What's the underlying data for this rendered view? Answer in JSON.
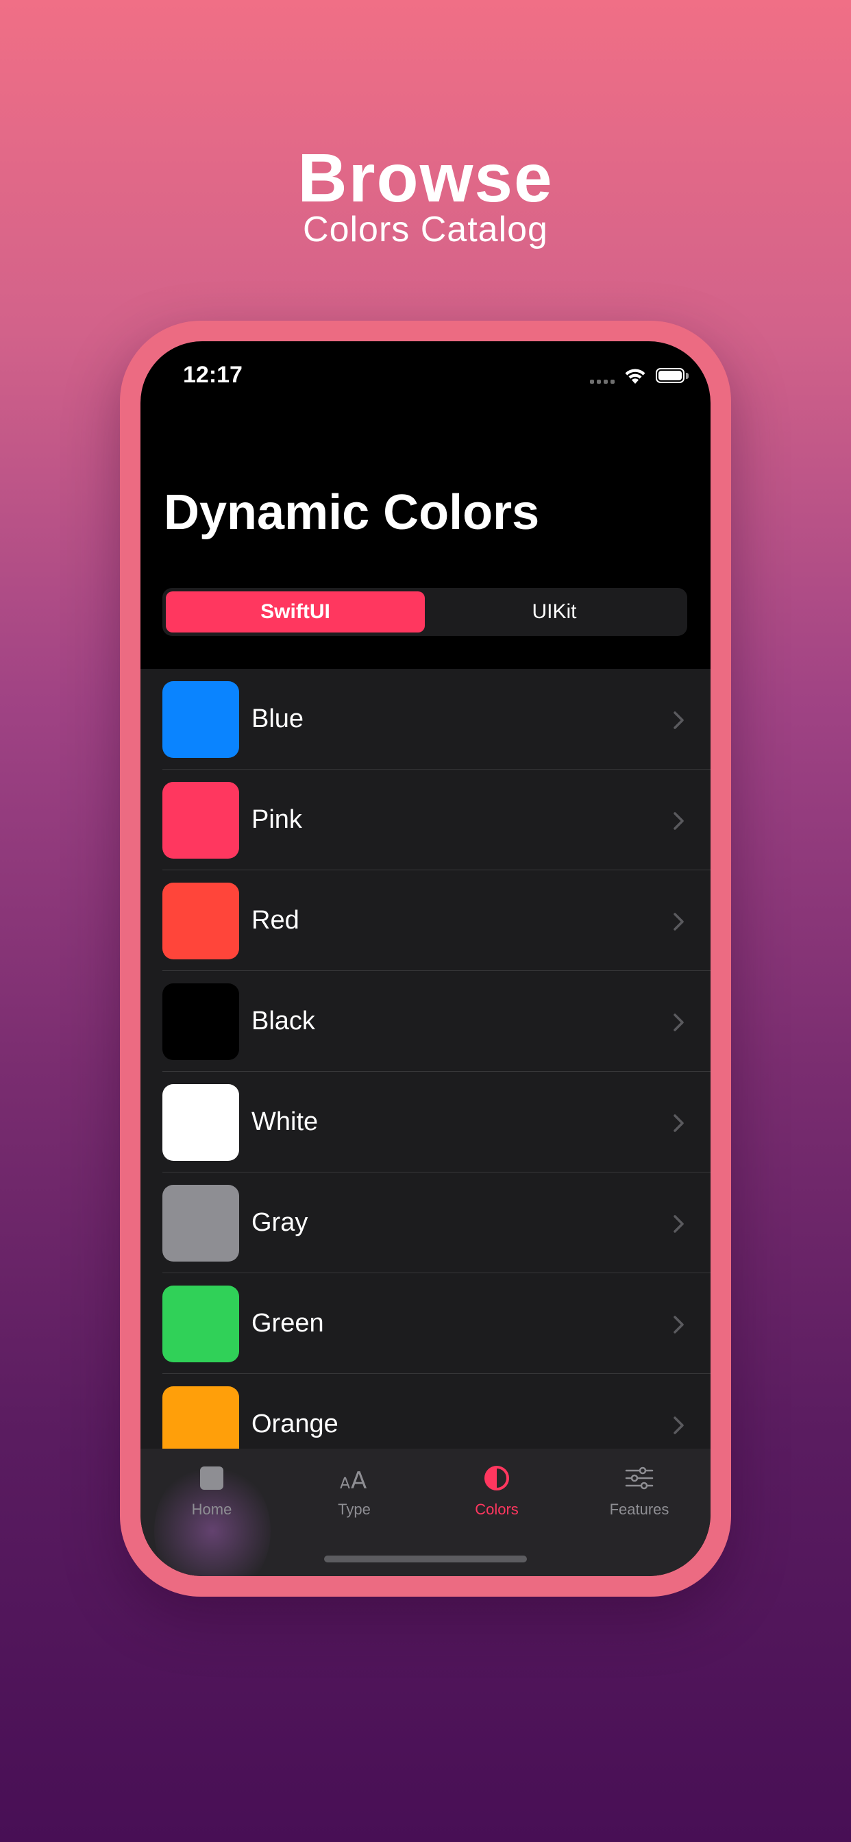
{
  "hero": {
    "title": "Browse",
    "subtitle": "Colors Catalog"
  },
  "status_bar": {
    "time": "12:17"
  },
  "page": {
    "title": "Dynamic Colors"
  },
  "segmented": {
    "options": [
      "SwiftUI",
      "UIKit"
    ],
    "selected": "SwiftUI"
  },
  "colors": [
    {
      "name": "Blue",
      "swatch": "#0a84ff"
    },
    {
      "name": "Pink",
      "swatch": "#ff375f"
    },
    {
      "name": "Red",
      "swatch": "#ff453a"
    },
    {
      "name": "Black",
      "swatch": "#000000"
    },
    {
      "name": "White",
      "swatch": "#ffffff"
    },
    {
      "name": "Gray",
      "swatch": "#8e8e93"
    },
    {
      "name": "Green",
      "swatch": "#30d158"
    },
    {
      "name": "Orange",
      "swatch": "#ff9f0a"
    }
  ],
  "tab_bar": {
    "items": [
      {
        "label": "Home",
        "icon": "square-icon"
      },
      {
        "label": "Type",
        "icon": "text-size-icon"
      },
      {
        "label": "Colors",
        "icon": "half-circle-icon"
      },
      {
        "label": "Features",
        "icon": "sliders-icon"
      }
    ],
    "active": "Colors"
  },
  "theme": {
    "accent": "#ff375f",
    "frame": "#ec6b82",
    "list_background": "#1c1c1e"
  }
}
